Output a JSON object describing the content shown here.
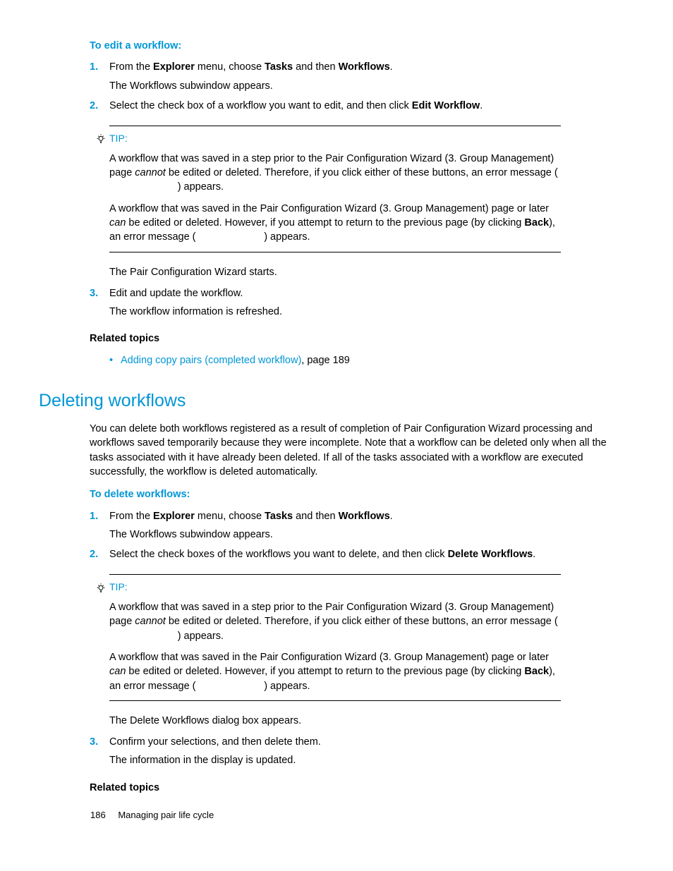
{
  "edit": {
    "heading": "To edit a workflow:",
    "steps": [
      {
        "num": "1.",
        "text_before_bold1": "From the ",
        "bold1": "Explorer",
        "text_mid1": " menu, choose ",
        "bold2": "Tasks",
        "text_mid2": " and then ",
        "bold3": "Workflows",
        "text_after": ".",
        "sub": "The Workflows subwindow appears."
      },
      {
        "num": "2.",
        "text_before_bold1": "Select the check box of a workflow you want to edit, and then click ",
        "bold1": "Edit Workflow",
        "text_after": "."
      },
      {
        "num": "3.",
        "text_before_bold1": "Edit and update the workflow.",
        "sub": "The workflow information is refreshed."
      }
    ],
    "after_tip": "The Pair Configuration Wizard starts."
  },
  "tip1": {
    "label": "TIP:",
    "p1a": "A workflow that was saved in a step prior to the Pair Configuration Wizard (3. Group Management) page ",
    "p1_italic": "cannot",
    "p1b": " be edited or deleted. Therefore, if you click either of these buttons, an error message (",
    "p1_gap": "                        ",
    "p1c": ") appears.",
    "p2a": "A workflow that was saved in the Pair Configuration Wizard (3. Group Management) page or later ",
    "p2_italic": "can",
    "p2b": " be edited or deleted. However, if you attempt to return to the previous page (by clicking ",
    "p2_bold": "Back",
    "p2c": "), an error message (",
    "p2_gap": "                        ",
    "p2d": ") appears."
  },
  "related1": {
    "heading": "Related topics",
    "link": "Adding copy pairs (completed workflow)",
    "suffix": ", page 189"
  },
  "delete": {
    "title": "Deleting workflows",
    "intro": "You can delete both workflows registered as a result of completion of Pair Configuration Wizard processing and workflows saved temporarily because they were incomplete. Note that a workflow can be deleted only when all the tasks associated with it have already been deleted. If all of the tasks associated with a workflow are executed successfully, the workflow is deleted automatically.",
    "heading": "To delete workflows:",
    "steps": [
      {
        "num": "1.",
        "text_before_bold1": "From the ",
        "bold1": "Explorer",
        "text_mid1": " menu, choose ",
        "bold2": "Tasks",
        "text_mid2": " and then ",
        "bold3": "Workflows",
        "text_after": ".",
        "sub": "The Workflows subwindow appears."
      },
      {
        "num": "2.",
        "text_before_bold1": "Select the check boxes of the workflows you want to delete, and then click ",
        "bold1": "Delete Workflows",
        "text_after": "."
      },
      {
        "num": "3.",
        "text_before_bold1": "Confirm your selections, and then delete them.",
        "sub": "The information in the display is updated."
      }
    ],
    "after_tip": "The Delete Workflows dialog box appears."
  },
  "tip2": {
    "label": "TIP:",
    "p1a": "A workflow that was saved in a step prior to the Pair Configuration Wizard (3. Group Management) page ",
    "p1_italic": "cannot",
    "p1b": " be edited or deleted. Therefore, if you click either of these buttons, an error message (",
    "p1_gap": "                        ",
    "p1c": ") appears.",
    "p2a": "A workflow that was saved in the Pair Configuration Wizard (3. Group Management) page or later ",
    "p2_italic": "can",
    "p2b": " be edited or deleted. However, if you attempt to return to the previous page (by clicking ",
    "p2_bold": "Back",
    "p2c": "), an error message (",
    "p2_gap": "                        ",
    "p2d": ") appears."
  },
  "related2": {
    "heading": "Related topics"
  },
  "footer": {
    "page": "186",
    "chapter": "Managing pair life cycle"
  }
}
